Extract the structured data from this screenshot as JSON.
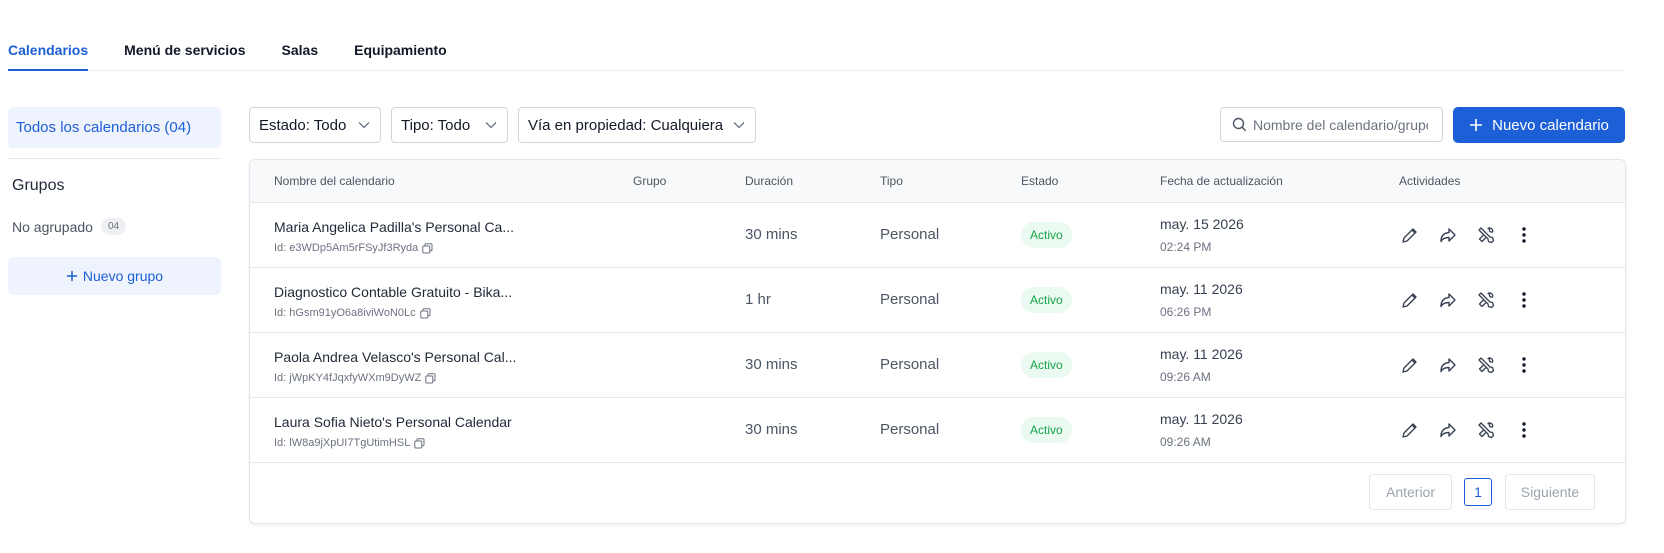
{
  "tabs": [
    {
      "label": "Calendarios",
      "active": true
    },
    {
      "label": "Menú de servicios",
      "active": false
    },
    {
      "label": "Salas",
      "active": false
    },
    {
      "label": "Equipamiento",
      "active": false
    }
  ],
  "sidebar": {
    "all_calendars": "Todos los calendarios (04)",
    "groups_title": "Grupos",
    "ungrouped_label": "No agrupado",
    "ungrouped_count": "04",
    "new_group_label": "Nuevo grupo"
  },
  "filters": {
    "status": "Estado: Todo",
    "type": "Tipo: Todo",
    "ownership": "Vía en propiedad: Cualquiera"
  },
  "search": {
    "placeholder": "Nombre del calendario/grupo",
    "value": ""
  },
  "new_calendar_label": "Nuevo calendario",
  "table": {
    "columns": [
      "Nombre del calendario",
      "Grupo",
      "Duración",
      "Tipo",
      "Estado",
      "Fecha de actualización",
      "Actividades"
    ],
    "rows": [
      {
        "name": "Maria Angelica Padilla's Personal Ca...",
        "id": "Id: e3WDp5Am5rFSyJf3Ryda",
        "group": "",
        "duration": "30 mins",
        "type": "Personal",
        "status": "Activo",
        "date": "may. 15 2026",
        "time": "02:24 PM"
      },
      {
        "name": "Diagnostico Contable Gratuito - Bika...",
        "id": "Id: hGsm91yO6a8iviWoN0Lc",
        "group": "",
        "duration": "1 hr",
        "type": "Personal",
        "status": "Activo",
        "date": "may. 11 2026",
        "time": "06:26 PM"
      },
      {
        "name": "Paola Andrea Velasco's Personal Cal...",
        "id": "Id: jWpKY4fJqxfyWXm9DyWZ",
        "group": "",
        "duration": "30 mins",
        "type": "Personal",
        "status": "Activo",
        "date": "may. 11 2026",
        "time": "09:26 AM"
      },
      {
        "name": "Laura Sofia Nieto's Personal Calendar",
        "id": "Id: lW8a9jXpUI7TgUtimHSL",
        "group": "",
        "duration": "30 mins",
        "type": "Personal",
        "status": "Activo",
        "date": "may. 11 2026",
        "time": "09:26 AM"
      }
    ]
  },
  "pagination": {
    "prev_label": "Anterior",
    "current_page": "1",
    "next_label": "Siguiente"
  },
  "icons": {
    "row_actions": [
      "pencil-icon",
      "share-icon",
      "tools-icon",
      "more-vertical-icon"
    ],
    "copy": "copy-icon",
    "search": "search-icon",
    "chevron": "chevron-down-icon",
    "plus": "plus-icon"
  },
  "colors": {
    "accent": "#1d5fd6",
    "status_active": "#16a34a",
    "status_active_bg": "#eafaf0"
  }
}
